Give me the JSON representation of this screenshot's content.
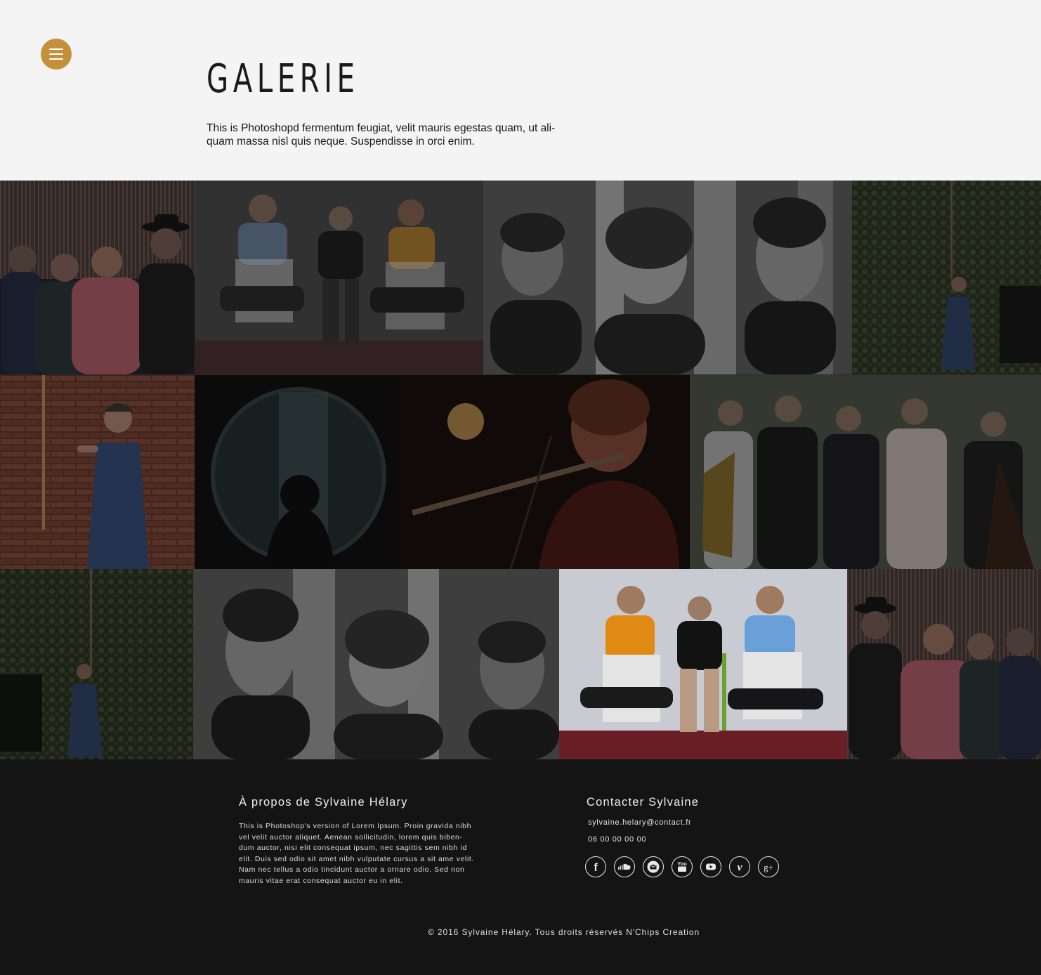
{
  "header": {
    "title": "GALERIE",
    "intro_line1": "This is Photoshopd fermentum feugiat, velit mauris egestas quam, ut ali-",
    "intro_line2": "quam massa nisl quis neque. Suspendisse in orci enim."
  },
  "menu": {
    "icon": "hamburger-menu-icon",
    "color": "#c4903a"
  },
  "gallery": {
    "photos": [
      {
        "name": "gallery-photo-quartet-striped-wall"
      },
      {
        "name": "gallery-photo-trio-seated-chairs"
      },
      {
        "name": "gallery-photo-trio-birch-bw"
      },
      {
        "name": "gallery-photo-woman-ivy-wall"
      },
      {
        "name": "gallery-photo-woman-brick-wall"
      },
      {
        "name": "gallery-photo-silhouette-round-window"
      },
      {
        "name": "gallery-photo-flutist-stage"
      },
      {
        "name": "gallery-photo-band-quintet"
      },
      {
        "name": "gallery-photo-woman-ivy-wall-2"
      },
      {
        "name": "gallery-photo-trio-birch-bw-2"
      },
      {
        "name": "gallery-photo-trio-seated-chairs-color"
      },
      {
        "name": "gallery-photo-quartet-striped-wall-2"
      }
    ]
  },
  "footer": {
    "about_title": "À propos de Sylvaine Hélary",
    "about_lines": [
      "This is Photoshop's version  of Lorem Ipsum. Proin gravida nibh",
      "vel velit auctor aliquet. Aenean sollicitudin, lorem quis biben-",
      "dum auctor, nisi elit consequat ipsum, nec sagittis sem nibh id",
      "elit. Duis sed odio sit amet nibh vulputate cursus a sit ame velit.",
      "Nam nec tellus a odio tincidunt auctor a ornare odio. Sed non",
      "mauris vitae erat consequat auctor eu in elit."
    ],
    "contact_title": "Contacter Sylvaine",
    "email": "sylvaine.helary@contact.fr",
    "phone": "06 00 00 00 00",
    "socials": [
      {
        "name": "facebook-icon",
        "glyph": "f"
      },
      {
        "name": "soundcloud-icon",
        "glyph": ""
      },
      {
        "name": "email-icon",
        "glyph": ""
      },
      {
        "name": "youtube-classic-icon",
        "glyph": "You"
      },
      {
        "name": "youtube-play-icon",
        "glyph": ""
      },
      {
        "name": "vimeo-icon",
        "glyph": "v"
      },
      {
        "name": "google-plus-icon",
        "glyph": "g+"
      }
    ],
    "copyright": "© 2016 Sylvaine Hélary. Tous droits réservés N'Chips Creation"
  },
  "colors": {
    "accent": "#c4903a",
    "footer_bg": "#141414",
    "header_bg": "#f4f4f4"
  }
}
